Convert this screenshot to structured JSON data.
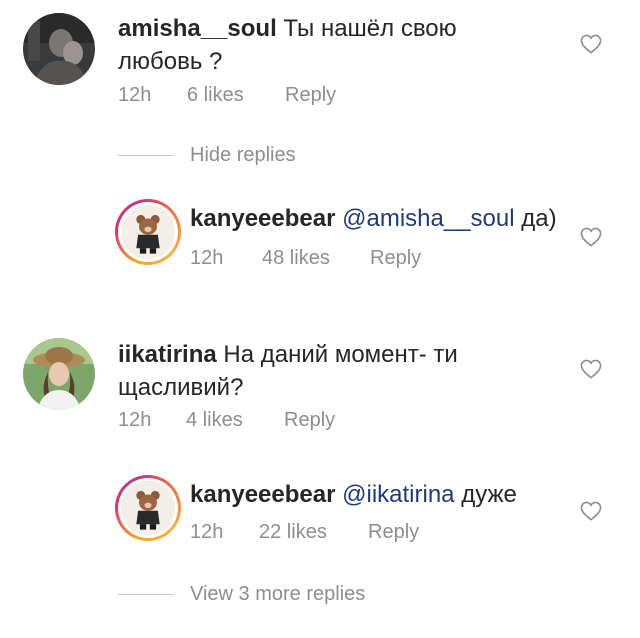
{
  "comments": [
    {
      "username": "amisha__soul",
      "text": "Ты нашёл свою любовь ?",
      "time": "12h",
      "likes": "6 likes",
      "reply": "Reply"
    },
    {
      "username": "iikatirina",
      "text": "На даний момент- ти щасливий?",
      "time": "12h",
      "likes": "4 likes",
      "reply": "Reply"
    }
  ],
  "replies": [
    {
      "username": "kanyeeebear",
      "mention": "@amisha__soul",
      "text": "да)",
      "time": "12h",
      "likes": "48 likes",
      "reply": "Reply"
    },
    {
      "username": "kanyeeebear",
      "mention": "@iikatirina",
      "text": "дуже",
      "time": "12h",
      "likes": "22 likes",
      "reply": "Reply"
    }
  ],
  "toggles": {
    "hide_replies": "Hide replies",
    "view_more": "View 3 more replies"
  },
  "icons": {
    "like": "heart-outline-icon",
    "story_ring": "gradient-ring"
  },
  "colors": {
    "text": "#262626",
    "meta": "#8e8e8e",
    "mention": "#1f3b7a"
  }
}
